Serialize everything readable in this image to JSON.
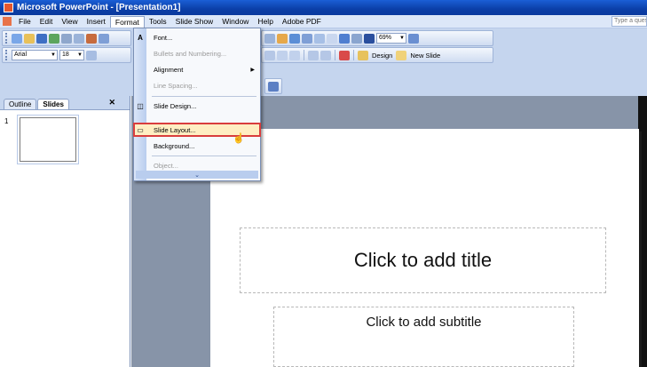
{
  "window": {
    "title": "Microsoft PowerPoint - [Presentation1]"
  },
  "menubar": {
    "items": [
      "File",
      "Edit",
      "View",
      "Insert",
      "Format",
      "Tools",
      "Slide Show",
      "Window",
      "Help",
      "Adobe PDF"
    ],
    "active": "Format",
    "help_placeholder": "Type a question for help"
  },
  "toolbar": {
    "font_name": "Arial",
    "font_size": "18",
    "zoom": "69%",
    "design_label": "Design",
    "new_slide_label": "New Slide"
  },
  "format_menu": {
    "items": [
      {
        "label": "Font...",
        "icon": "font-icon",
        "disabled": false,
        "submenu": false
      },
      {
        "label": "Bullets and Numbering...",
        "icon": "",
        "disabled": true,
        "submenu": false
      },
      {
        "label": "Alignment",
        "icon": "",
        "disabled": false,
        "submenu": true
      },
      {
        "label": "Line Spacing...",
        "icon": "",
        "disabled": true,
        "submenu": false
      },
      {
        "label": "Slide Design...",
        "icon": "slide-design-icon",
        "disabled": false,
        "submenu": false
      },
      {
        "label": "Slide Layout...",
        "icon": "slide-layout-icon",
        "disabled": false,
        "submenu": false,
        "highlighted": true
      },
      {
        "label": "Background...",
        "icon": "",
        "disabled": false,
        "submenu": false
      },
      {
        "label": "Object...",
        "icon": "",
        "disabled": true,
        "submenu": false
      }
    ],
    "expand_icon": "chevron-double-down-icon"
  },
  "left_pane": {
    "tabs": [
      "Outline",
      "Slides"
    ],
    "active_tab": "Slides",
    "slide_number": "1"
  },
  "slide": {
    "title_placeholder": "Click to add title",
    "subtitle_placeholder": "Click to add subtitle"
  },
  "colors": {
    "titlebar": "#0b3fa8",
    "menu_highlight_border": "#d93d3d",
    "workarea": "#8794a8"
  }
}
